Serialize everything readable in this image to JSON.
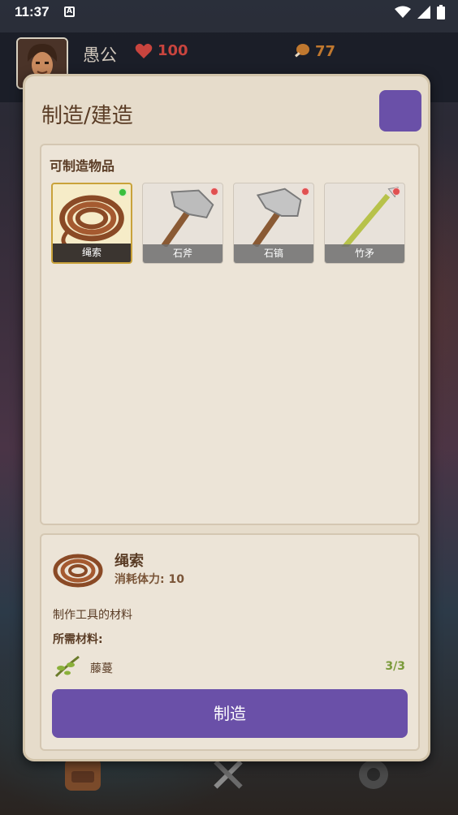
{
  "status_bar": {
    "time": "11:37",
    "app_badge": "A"
  },
  "hud": {
    "player_name": "愚公",
    "hp": "100",
    "food": "77"
  },
  "dialog": {
    "title": "制造/建造",
    "section_title": "可制造物品",
    "items": [
      {
        "label": "绳索",
        "status": "available",
        "icon": "rope-icon"
      },
      {
        "label": "石斧",
        "status": "unavailable",
        "icon": "stone-axe-icon"
      },
      {
        "label": "石镐",
        "status": "unavailable",
        "icon": "stone-pickaxe-icon"
      },
      {
        "label": "竹矛",
        "status": "unavailable",
        "icon": "bamboo-spear-icon"
      }
    ],
    "detail": {
      "name": "绳索",
      "cost": "消耗体力: 10",
      "description": "制作工具的材料",
      "required_title": "所需材料:",
      "materials": [
        {
          "name": "藤蔓",
          "count": "3/3",
          "icon": "vine-icon"
        }
      ],
      "craft_button": "制造"
    }
  },
  "colors": {
    "accent": "#6a50a8",
    "available_dot": "#3bbf3b",
    "unavailable_dot": "#e05050",
    "text_brown": "#5a3c25"
  }
}
